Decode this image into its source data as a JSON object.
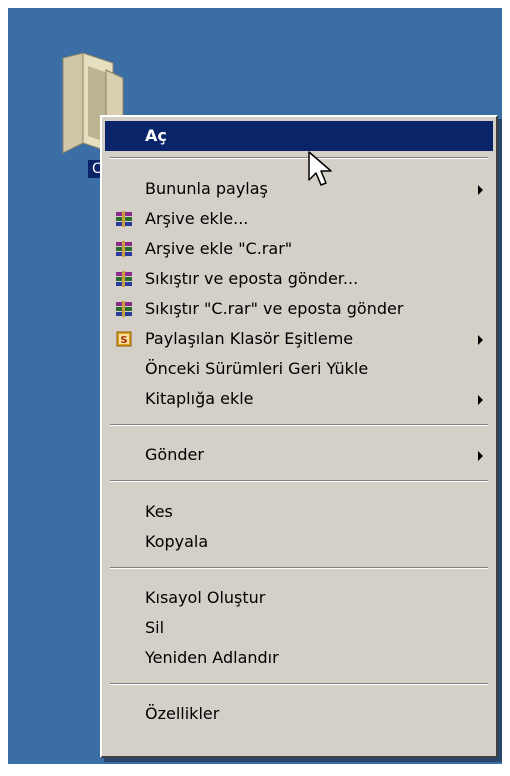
{
  "desktop": {
    "folder_label": "C"
  },
  "menu": {
    "items": [
      {
        "label": "Aç",
        "icon": "",
        "submenu": false,
        "selected": true
      },
      {
        "label": "Bununla paylaş",
        "icon": "",
        "submenu": true
      },
      {
        "label": "Arşive ekle...",
        "icon": "winrar-icon",
        "submenu": false
      },
      {
        "label": "Arşive ekle \"C.rar\"",
        "icon": "winrar-icon",
        "submenu": false
      },
      {
        "label": "Sıkıştır ve eposta gönder...",
        "icon": "winrar-icon",
        "submenu": false
      },
      {
        "label": "Sıkıştır \"C.rar\" ve eposta gönder",
        "icon": "winrar-icon",
        "submenu": false
      },
      {
        "label": "Paylaşılan Klasör Eşitleme",
        "icon": "sync-s-icon",
        "submenu": true
      },
      {
        "label": "Önceki Sürümleri Geri Yükle",
        "icon": "",
        "submenu": false
      },
      {
        "label": "Kitaplığa ekle",
        "icon": "",
        "submenu": true
      },
      {
        "label": "Gönder",
        "icon": "",
        "submenu": true
      },
      {
        "label": "Kes",
        "icon": "",
        "submenu": false
      },
      {
        "label": "Kopyala",
        "icon": "",
        "submenu": false
      },
      {
        "label": "Kısayol Oluştur",
        "icon": "",
        "submenu": false
      },
      {
        "label": "Sil",
        "icon": "",
        "submenu": false
      },
      {
        "label": "Yeniden Adlandır",
        "icon": "",
        "submenu": false
      },
      {
        "label": "Özellikler",
        "icon": "",
        "submenu": false
      }
    ]
  },
  "colors": {
    "desktop": "#3c6ea6",
    "menu_bg": "#d4d0c8",
    "highlight": "#0a246a"
  }
}
